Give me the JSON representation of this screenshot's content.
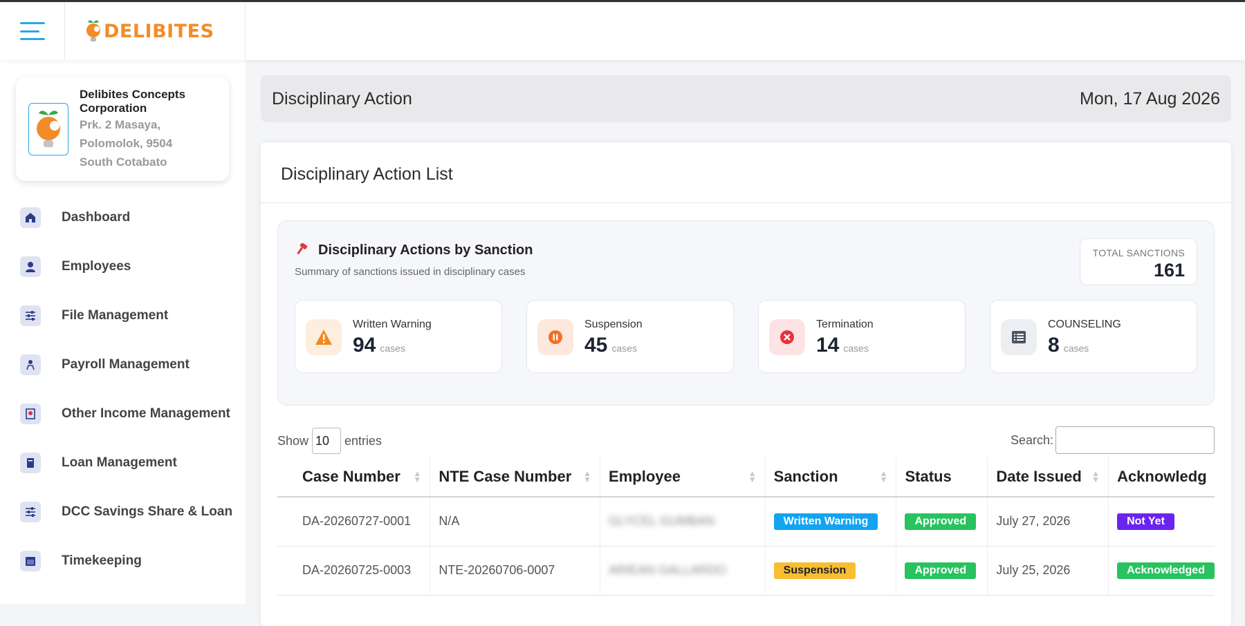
{
  "app": {
    "brand": "DELIBITES",
    "colors": {
      "accent": "#29a8e0",
      "brand": "#f28c28"
    }
  },
  "company": {
    "name": "Delibites Concepts Corporation",
    "address_line1": "Prk. 2 Masaya,",
    "address_line2": "Polomolok, 9504",
    "address_line3": "South Cotabato"
  },
  "sidebar": {
    "items": [
      {
        "label": "Dashboard",
        "icon": "home-icon"
      },
      {
        "label": "Employees",
        "icon": "employees-icon"
      },
      {
        "label": "File Management",
        "icon": "sliders-icon"
      },
      {
        "label": "Payroll Management",
        "icon": "payroll-icon"
      },
      {
        "label": "Other Income Management",
        "icon": "income-icon"
      },
      {
        "label": "Loan Management",
        "icon": "book-icon"
      },
      {
        "label": "DCC Savings Share & Loan",
        "icon": "sliders-icon"
      },
      {
        "label": "Timekeeping",
        "icon": "calendar-icon"
      }
    ]
  },
  "header": {
    "title": "Disciplinary Action",
    "date": "Mon, 17 Aug 2026"
  },
  "card": {
    "title": "Disciplinary Action List"
  },
  "summary": {
    "title": "Disciplinary Actions by Sanction",
    "subtitle": "Summary of sanctions issued in disciplinary cases",
    "total_label": "TOTAL SANCTIONS",
    "total_value": "161",
    "unit": "cases",
    "stats": [
      {
        "label": "Written Warning",
        "value": "94",
        "icon": "warning-icon",
        "color": "#f08a24"
      },
      {
        "label": "Suspension",
        "value": "45",
        "icon": "pause-icon",
        "color": "#f37021"
      },
      {
        "label": "Termination",
        "value": "14",
        "icon": "close-circle-icon",
        "color": "#e5343a"
      },
      {
        "label": "COUNSELING",
        "value": "8",
        "icon": "list-icon",
        "color": "#4b5563"
      }
    ]
  },
  "table_controls": {
    "show_label": "Show",
    "entries_value": "10",
    "entries_label": "entries",
    "search_label": "Search:"
  },
  "table": {
    "columns": [
      "Case Number",
      "NTE Case Number",
      "Employee",
      "Sanction",
      "Status",
      "Date Issued",
      "Acknowledg"
    ],
    "rows": [
      {
        "case_number": "DA-20260727-0001",
        "nte_case_number": "N/A",
        "employee": "GLYCEL GUMBAN",
        "sanction": "Written Warning",
        "status": "Approved",
        "date_issued": "July 27, 2026",
        "acknowledgement": "Not Yet"
      },
      {
        "case_number": "DA-20260725-0003",
        "nte_case_number": "NTE-20260706-0007",
        "employee": "ARIEAN GALLARDO",
        "sanction": "Suspension",
        "status": "Approved",
        "date_issued": "July 25, 2026",
        "acknowledgement": "Acknowledged"
      }
    ]
  }
}
